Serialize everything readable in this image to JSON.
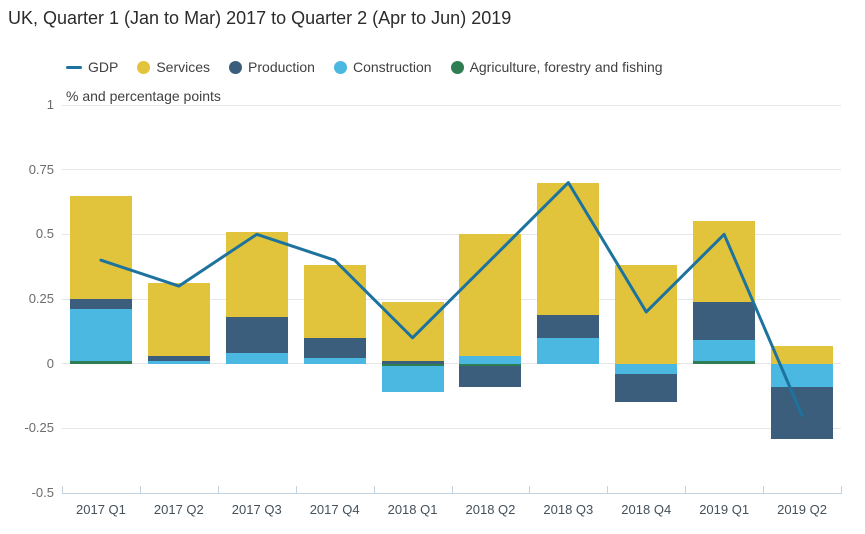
{
  "chart_data": {
    "type": "bar+line (stacked contribution chart)",
    "title": "UK, Quarter 1 (Jan to Mar) 2017 to Quarter 2 (Apr to Jun) 2019",
    "unit_label": "% and percentage points",
    "categories": [
      "2017 Q1",
      "2017 Q2",
      "2017 Q3",
      "2017 Q4",
      "2018 Q1",
      "2018 Q2",
      "2018 Q3",
      "2018 Q4",
      "2019 Q1",
      "2019 Q2"
    ],
    "series": [
      {
        "name": "GDP",
        "type": "line",
        "color": "#1d739e",
        "values": [
          0.4,
          0.3,
          0.5,
          0.4,
          0.1,
          0.4,
          0.7,
          0.2,
          0.5,
          -0.2
        ]
      },
      {
        "name": "Services",
        "type": "bar",
        "color": "#e2c43c",
        "values": [
          0.4,
          0.28,
          0.33,
          0.28,
          0.23,
          0.47,
          0.51,
          0.38,
          0.31,
          0.07
        ]
      },
      {
        "name": "Production",
        "type": "bar",
        "color": "#3a5e7c",
        "values": [
          0.04,
          0.02,
          0.14,
          0.08,
          0.01,
          -0.08,
          0.09,
          -0.11,
          0.15,
          -0.2
        ]
      },
      {
        "name": "Construction",
        "type": "bar",
        "color": "#4ab8e0",
        "values": [
          0.2,
          0.01,
          0.04,
          0.02,
          -0.1,
          0.03,
          0.1,
          -0.04,
          0.08,
          -0.09
        ]
      },
      {
        "name": "Agriculture, forestry and fishing",
        "type": "bar",
        "color": "#2f7d52",
        "values": [
          0.01,
          0,
          0,
          0,
          -0.01,
          -0.01,
          0,
          0,
          0.01,
          0
        ]
      }
    ],
    "stack_order": [
      "Agriculture, forestry and fishing",
      "Construction",
      "Production",
      "Services"
    ],
    "y_ticks": [
      "1",
      "0.75",
      "0.5",
      "0.25",
      "0",
      "-0.25",
      "-0.5"
    ],
    "ylim": [
      -0.5,
      1
    ],
    "grid": true,
    "legend_position": "top"
  }
}
